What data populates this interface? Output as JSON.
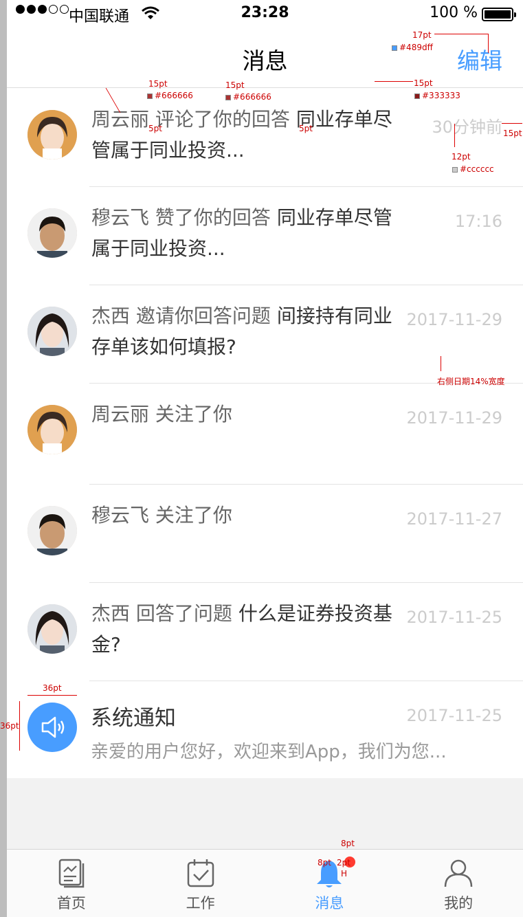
{
  "status_bar": {
    "carrier": "中国联通",
    "time": "23:28",
    "battery": "100 %"
  },
  "nav": {
    "title": "消息",
    "edit_label": "编辑"
  },
  "messages": [
    {
      "name": "周云丽",
      "action": "评论了你的回答",
      "content": "同业存单尽管属于同业投资...",
      "time": "30分钟前",
      "avatar": "female-1"
    },
    {
      "name": "穆云飞",
      "action": "赞了你的回答",
      "content": "同业存单尽管属于同业投资...",
      "time": "17:16",
      "avatar": "male-1"
    },
    {
      "name": "杰西",
      "action": "邀请你回答问题",
      "content": "间接持有同业存单该如何填报?",
      "time": "2017-11-29",
      "avatar": "female-2"
    },
    {
      "name": "周云丽",
      "action": "关注了你",
      "content": "",
      "time": "2017-11-29",
      "avatar": "female-1"
    },
    {
      "name": "穆云飞",
      "action": "关注了你",
      "content": "",
      "time": "2017-11-27",
      "avatar": "male-1"
    },
    {
      "name": "杰西",
      "action": "回答了问题",
      "content": "什么是证券投资基金?",
      "time": "2017-11-25",
      "avatar": "female-2"
    }
  ],
  "system_notice": {
    "title": "系统通知",
    "subtitle": "亲爱的用户您好，欢迎来到App，我们为您...",
    "time": "2017-11-25",
    "icon": "speaker-icon"
  },
  "tabs": [
    {
      "label": "首页",
      "icon": "home-doc-icon",
      "active": false
    },
    {
      "label": "工作",
      "icon": "calendar-check-icon",
      "active": false
    },
    {
      "label": "消息",
      "icon": "bell-icon",
      "active": true
    },
    {
      "label": "我的",
      "icon": "person-icon",
      "active": false
    }
  ],
  "colors": {
    "accent": "#489dff",
    "name_action": "#666666",
    "content": "#333333",
    "time": "#cccccc"
  },
  "annotations": {
    "edit_size": "17pt",
    "edit_color": "#489dff",
    "name_size": "15pt",
    "name_color": "#666666",
    "action_size": "15pt",
    "action_color": "#666666",
    "content_size": "15pt",
    "content_color": "#333333",
    "gap_1": "5pt",
    "gap_2": "5pt",
    "time_size": "12pt",
    "time_color": "#cccccc",
    "right_margin": "15pt",
    "date_width": "右侧日期14%宽度",
    "icon_width": "36pt",
    "icon_height": "36pt",
    "badge_size": "8pt",
    "badge_offset": "8pt",
    "badge_gap": "2pt",
    "badge_h": "H"
  }
}
